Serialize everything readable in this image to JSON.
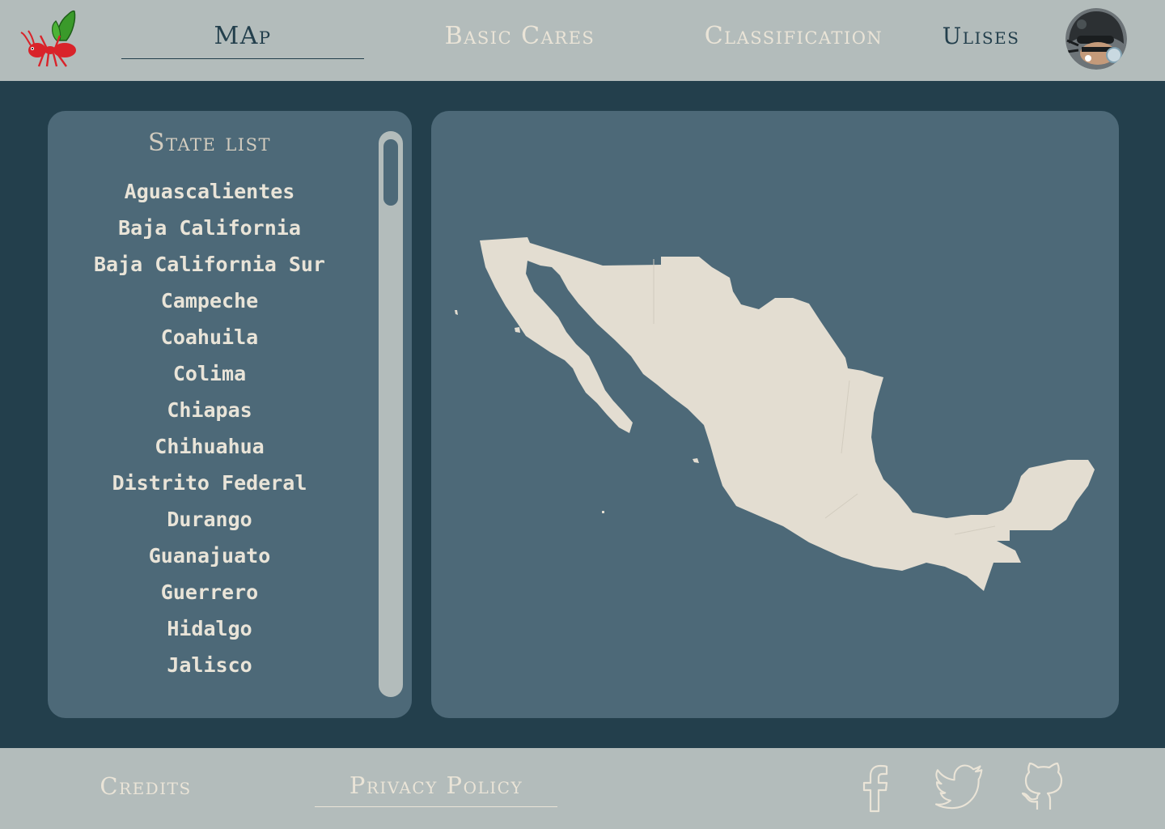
{
  "header": {
    "nav": {
      "map": "MAp",
      "basic_cares": "Basic Cares",
      "classification": "Classification",
      "user": "Ulises"
    },
    "logo_icon": "ant-logo-icon",
    "avatar_icon": "user-avatar"
  },
  "state_panel": {
    "title": "State list",
    "states": [
      "Aguascalientes",
      "Baja California",
      "Baja California Sur",
      "Campeche",
      "Coahuila",
      "Colima",
      "Chiapas",
      "Chihuahua",
      "Distrito Federal",
      "Durango",
      "Guanajuato",
      "Guerrero",
      "Hidalgo",
      "Jalisco"
    ]
  },
  "map": {
    "icon": "mexico-map"
  },
  "footer": {
    "credits": "Credits",
    "privacy": "Privacy Policy",
    "social_icons": [
      "facebook-icon",
      "twitter-icon",
      "github-icon"
    ]
  },
  "colors": {
    "background": "#233f4c",
    "bar": "#b3bcbb",
    "panel": "#4d6978",
    "land": "#e3ddd1",
    "text_light": "#eae4d7"
  }
}
